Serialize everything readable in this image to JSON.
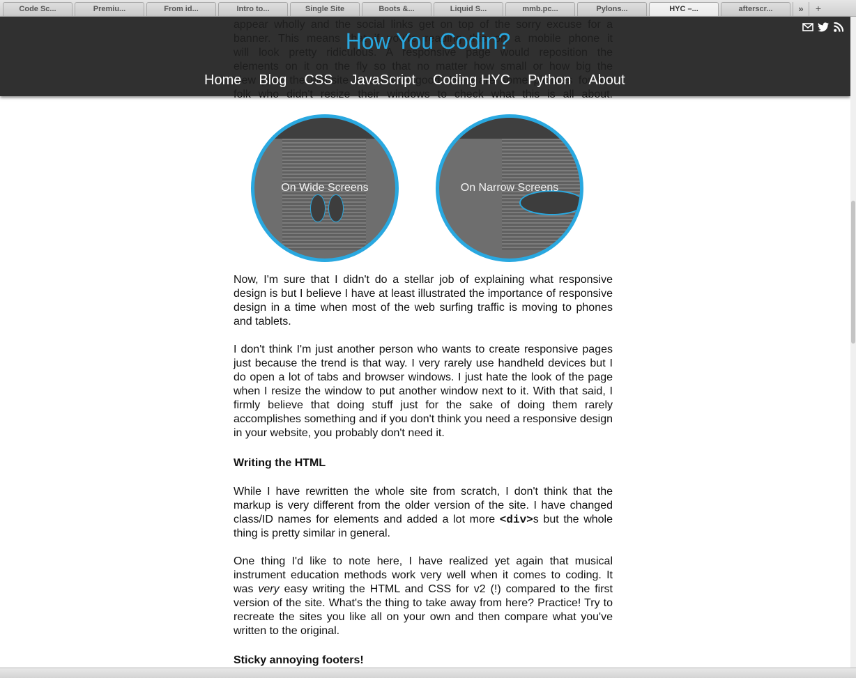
{
  "browser": {
    "tabs": [
      {
        "label": "Code Sc..."
      },
      {
        "label": "Premiu..."
      },
      {
        "label": "From id..."
      },
      {
        "label": "Intro to..."
      },
      {
        "label": "Single Site"
      },
      {
        "label": "Boots &..."
      },
      {
        "label": "Liquid S..."
      },
      {
        "label": "mmb.pc..."
      },
      {
        "label": "Pylons..."
      },
      {
        "label": "HYC –..."
      },
      {
        "label": "afterscr..."
      }
    ],
    "more_label": "»",
    "new_tab_label": "+"
  },
  "site": {
    "logo": "How You Codin?",
    "nav": [
      {
        "label": "Home"
      },
      {
        "label": "Blog"
      },
      {
        "label": "CSS"
      },
      {
        "label": "JavaScript"
      },
      {
        "label": "Coding HYC"
      },
      {
        "label": "Python"
      },
      {
        "label": "About"
      }
    ],
    "social_icons": [
      "mail-icon",
      "twitter-icon",
      "rss-icon"
    ]
  },
  "article": {
    "intro_lines": [
      "appear wholly and the social links get on top of the sorry excuse for a",
      "banner. This means that if you're reading this on a mobile phone it",
      "will look pretty ridiculous. A responsive page would reposition the",
      "elements on it on the fly so that no matter how small or how big the",
      "view port, the website would look good. Here are some pictures for the",
      "folk who didn't resize their windows to check what this is all about."
    ],
    "circle_wide_caption": "On Wide Screens",
    "circle_narrow_caption": "On Narrow Screens",
    "p1": "Now, I'm sure that I didn't do a stellar job of explaining what responsive design is but I believe I have at least illustrated the importance of responsive design in a time when most of the web surfing traffic is moving to phones and tablets.",
    "p2": "I don't think I'm just another person who wants to create responsive pages just because the trend is that way. I very rarely use handheld devices but I do open a lot of tabs and browser windows. I just hate the look of the page when I resize the window to put another window next to it. With that said, I firmly believe that doing stuff just for the sake of doing them rarely accomplishes something and if you don't think you need a responsive design in your website, you probably don't need it.",
    "h1": "Writing the HTML",
    "p3_a": "While I have rewritten the whole site from scratch, I don't think that the markup is very different from the older version of the site. I have changed class/ID names for elements and added a lot more ",
    "p3_code": "<div>",
    "p3_b": "s but the whole thing is pretty similar in general.",
    "p4_a": "One thing I'd like to note here, I have realized yet again that musical instrument education methods work very well when it comes to coding. It was ",
    "p4_em": "very",
    "p4_b": " easy writing the HTML and CSS for v2 (!) compared to the first version of the site. What's the thing to take away from here? Practice! Try to recreate the sites you like all on your own and then compare what you've written to the original.",
    "h2": "Sticky annoying footers!"
  }
}
